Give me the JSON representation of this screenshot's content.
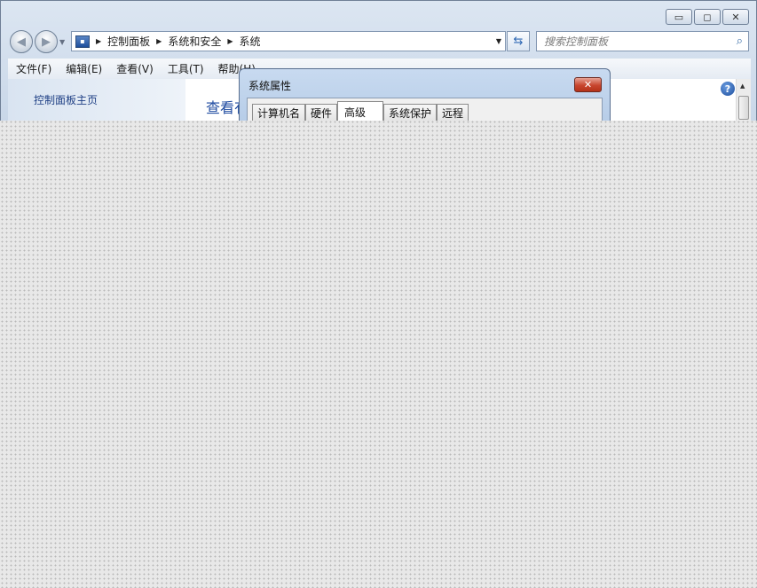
{
  "window": {
    "caption_buttons": [
      {
        "name": "minimize",
        "glyph": "▭"
      },
      {
        "name": "maximize",
        "glyph": "◻"
      },
      {
        "name": "close",
        "glyph": "✕"
      }
    ]
  },
  "address": {
    "crumbs": [
      "控制面板",
      "系统和安全",
      "系统"
    ]
  },
  "search": {
    "placeholder": "搜索控制面板"
  },
  "menu": {
    "items": [
      "文件(F)",
      "编辑(E)",
      "查看(V)",
      "工具(T)",
      "帮助(H)"
    ]
  },
  "left_pane": {
    "home_link": "控制面板主页"
  },
  "main": {
    "heading": "查看有"
  },
  "dialog": {
    "title": "系统属性",
    "tabs": [
      "计算机名",
      "硬件",
      "高级",
      "系统保护",
      "远程"
    ],
    "active_tab": "高级"
  }
}
